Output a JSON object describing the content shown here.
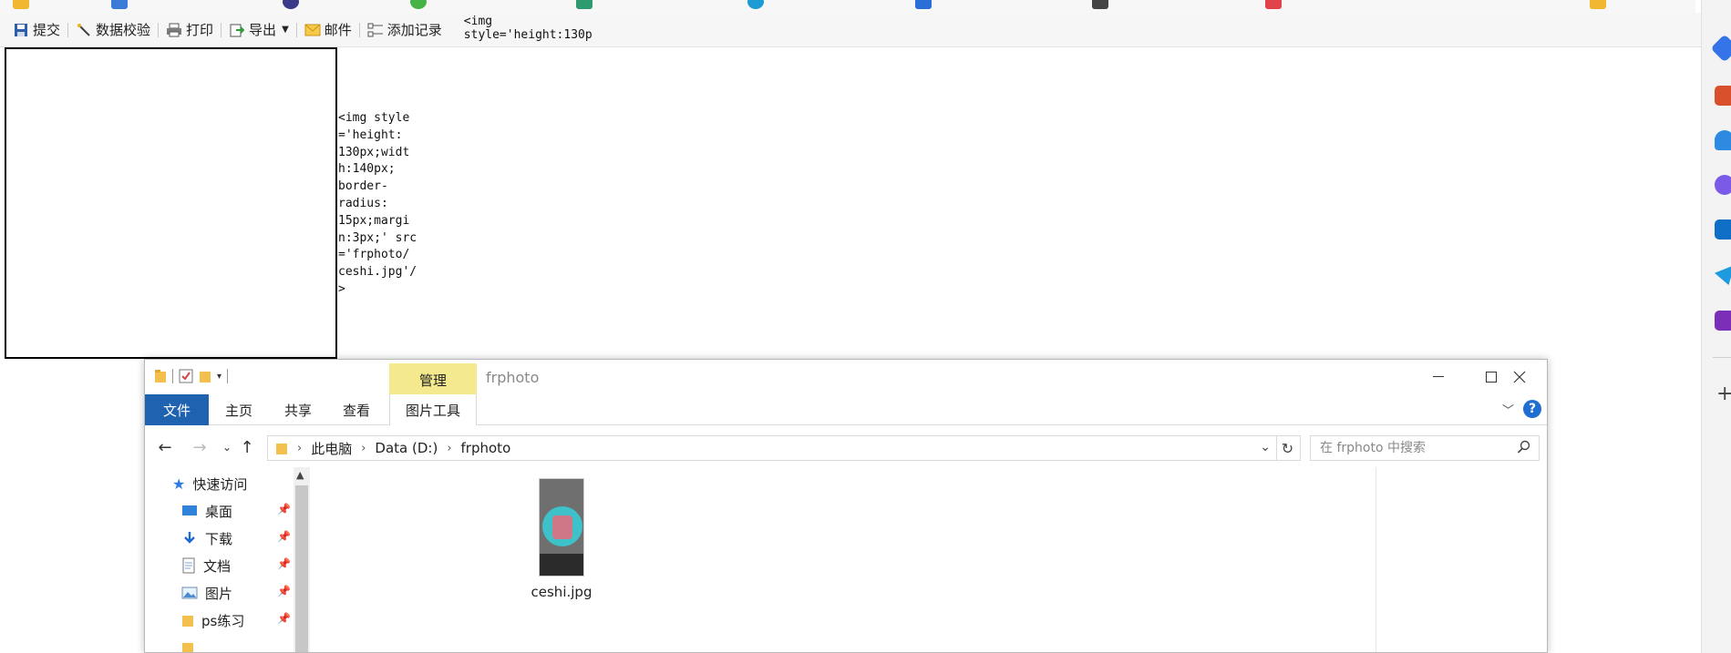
{
  "toolbar": {
    "submit": "提交",
    "validate": "数据校验",
    "print": "打印",
    "export": "导出",
    "mail": "邮件",
    "add_record": "添加记录",
    "code_preview": "<img\nstyle='height:130p"
  },
  "report": {
    "cell_text": "<img style\n='height:\n130px;widt\nh:140px;\nborder-\nradius:\n15px;margi\nn:3px;' src\n='frphoto/\nceshi.jpg'/\n>"
  },
  "explorer": {
    "manage_tab": "管理",
    "window_title": "frphoto",
    "ribbon_tabs": [
      "文件",
      "主页",
      "共享",
      "查看",
      "图片工具"
    ],
    "breadcrumb": [
      "此电脑",
      "Data (D:)",
      "frphoto"
    ],
    "search_placeholder": "在 frphoto 中搜索",
    "help_label": "?",
    "nav": {
      "quick_access": "快速访问",
      "items": [
        "桌面",
        "下载",
        "文档",
        "图片",
        "ps练习"
      ]
    },
    "file": {
      "name": "ceshi.jpg"
    }
  },
  "colors": {
    "file_tab_blue": "#1f63b0",
    "manage_tab_yellow": "#f4e98c",
    "help_blue": "#1e6fd0"
  }
}
